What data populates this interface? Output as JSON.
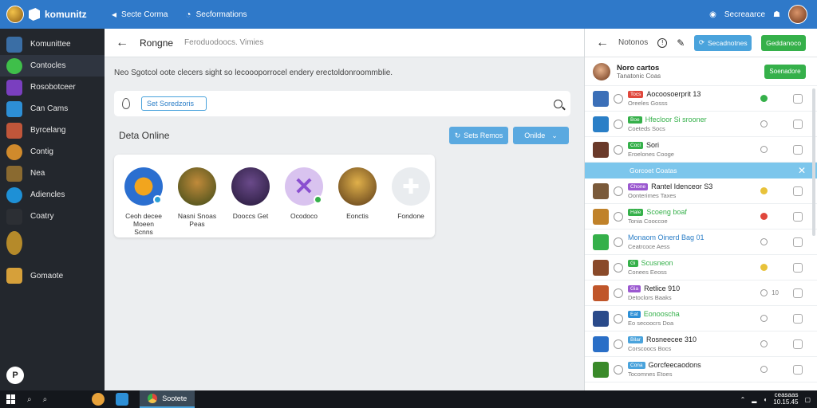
{
  "topbar": {
    "brand": "komunitz",
    "nav1": "Secte Corma",
    "nav2": "Secformations",
    "right_label": "Secreaarce"
  },
  "sidebar": {
    "items": [
      {
        "label": "Komunittee",
        "color": "#3a6ea5"
      },
      {
        "label": "Contocles",
        "color": "#3fbf4a"
      },
      {
        "label": "Rosobotceer",
        "color": "#7a3fbf"
      },
      {
        "label": "Can Cams",
        "color": "#2d8fd6"
      },
      {
        "label": "Byrcelang",
        "color": "#c0563a"
      },
      {
        "label": "Contig",
        "color": "#d08a2c"
      },
      {
        "label": "Nea",
        "color": "#8a6a30"
      },
      {
        "label": "Adiencles",
        "color": "#1e90d6"
      },
      {
        "label": "Coatry",
        "color": "#2c2f34"
      },
      {
        "label": "",
        "color": "#b58a2a"
      },
      {
        "label": "",
        "color": "#23272d"
      },
      {
        "label": "Gomaote",
        "color": "#d6a03a"
      }
    ],
    "bottom_letter": "P"
  },
  "main": {
    "title": "Rongne",
    "subtitle": "Feroduodoocs. Vimies",
    "notice": "Neo Sgotcol oote clecers sight so lecoooporrocel endery erectoldonroommblie.",
    "search_value": "Set Soredzoris",
    "section_title": "Deta Online",
    "btn_primary": "Sets Remos",
    "btn_secondary": "Onilde",
    "friends": [
      {
        "name": "Ceoh decee\nMoeen Scnns",
        "bg": "radial-gradient(circle,#f2a51e 0 35%,#2b6fd0 36% 100%)",
        "dot": "#2b9fd6"
      },
      {
        "name": "Nasni Snoas\nPeas",
        "bg": "radial-gradient(circle at 50% 40%,#c08a3a,#3d4a18)",
        "dot": ""
      },
      {
        "name": "Dooccs Get",
        "bg": "radial-gradient(circle at 50% 40%,#6a4a8a,#241838)",
        "dot": ""
      },
      {
        "name": "Ocodoco",
        "bg": "#d9c3ef",
        "dot": "#35b04a"
      },
      {
        "name": "Eonctis",
        "bg": "radial-gradient(circle at 50% 40%,#e0b04a,#5a3a18)",
        "dot": ""
      },
      {
        "name": "Fondone",
        "bg": "#e9ecef",
        "dot": ""
      }
    ]
  },
  "panel": {
    "title": "Notonos",
    "btn_primary": "Secadnotnes",
    "btn_secondary": "Geddanoco",
    "me": {
      "name": "Noro cartos",
      "sub": "Tanatonic Coas",
      "action": "Soenadore"
    },
    "rows": [
      {
        "tag": "Tocs",
        "tag_color": "#e0473c",
        "title": "Aocoosoerprit 13",
        "sub": "Oreeles Gosss",
        "avatar": "#3b6fb8",
        "status": "#35b04a",
        "num": "",
        "title_color": "#222"
      },
      {
        "tag": "Boe",
        "tag_color": "#35b04a",
        "title": "Hfecloor Si srooner",
        "sub": "Coeteds Socs",
        "avatar": "#2a7fc7",
        "status": "",
        "num": "",
        "title_color": "#35b04a"
      },
      {
        "tag": "Cocl",
        "tag_color": "#35b04a",
        "title": "Sori",
        "sub": "Eroelones Cooge",
        "avatar": "#6a3a2a",
        "status": "",
        "num": "",
        "title_color": "#222"
      },
      {
        "tag": "Chone",
        "tag_color": "#9b59d0",
        "title": "Rantel Idenceor S3",
        "sub": "Oonterimes Taxes",
        "avatar": "#7a5a3a",
        "status": "#e8c23a",
        "num": "",
        "title_color": "#222"
      },
      {
        "tag": "Hale",
        "tag_color": "#35b04a",
        "title": "Scoeng boaf",
        "sub": "Tonia Cooccoe",
        "avatar": "#c0822a",
        "status": "#e0473c",
        "num": "",
        "title_color": "#35b04a"
      },
      {
        "tag": "",
        "tag_color": "",
        "title": "Monaom Oinerd Bag 01",
        "sub": "Ceatrcoce Aess",
        "avatar": "#35b04a",
        "status": "",
        "num": "",
        "title_color": "#2b7ec7"
      },
      {
        "tag": "Gi",
        "tag_color": "#35b04a",
        "title": "Scusneon",
        "sub": "Conees Eeoss",
        "avatar": "#8a4a2a",
        "status": "#e8c23a",
        "num": "",
        "title_color": "#35b04a"
      },
      {
        "tag": "Gia",
        "tag_color": "#9b59d0",
        "title": "Retlice 910",
        "sub": "Detoclors Baaks",
        "avatar": "#c0562a",
        "status": "",
        "num": "10",
        "title_color": "#222"
      },
      {
        "tag": "Eat",
        "tag_color": "#2d8fd6",
        "title": "Eonooscha",
        "sub": "Eo secoocrs Doa",
        "avatar": "#2a4a8a",
        "status": "",
        "num": "",
        "title_color": "#35b04a"
      },
      {
        "tag": "Bilar",
        "tag_color": "#4aa3dc",
        "title": "Rosneecee 310",
        "sub": "Corscoocs Bocs",
        "avatar": "#2a6fc7",
        "status": "",
        "num": "",
        "title_color": "#222"
      },
      {
        "tag": "Cona",
        "tag_color": "#4aa3dc",
        "title": "Gorcfeecaodons",
        "sub": "Tocomnes Etoes",
        "avatar": "#3a8a2a",
        "status": "",
        "num": "",
        "title_color": "#222"
      }
    ],
    "banner": "Gorcoet Coatas"
  },
  "taskbar": {
    "active_app": "Sootete",
    "clock": "ceasaas",
    "date": "10.15.45"
  }
}
